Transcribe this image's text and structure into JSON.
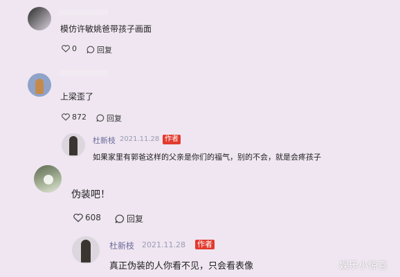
{
  "comments": [
    {
      "text": "模仿许敏姚爸带孩子画面",
      "likes": "0",
      "reply_label": "回复"
    },
    {
      "text": "上梁歪了",
      "likes": "872",
      "reply_label": "回复",
      "author_reply": {
        "name": "杜新枝",
        "date": "2021.11.28",
        "badge": "作者",
        "text": "如果家里有郭爸这样的父亲是你们的福气，别的不会，就是会疼孩子"
      }
    },
    {
      "text": "伪装吧！",
      "likes": "608",
      "reply_label": "回复",
      "author_reply": {
        "name": "杜新枝",
        "date": "2021.11.28",
        "badge": "作者",
        "text": "真正伪装的人你看不见，只会看表像"
      }
    }
  ],
  "watermark": "娱乐小惊喜",
  "colors": {
    "background": "#efe6f1",
    "badge": "#e23a2e",
    "username": "#6b6b9a"
  }
}
